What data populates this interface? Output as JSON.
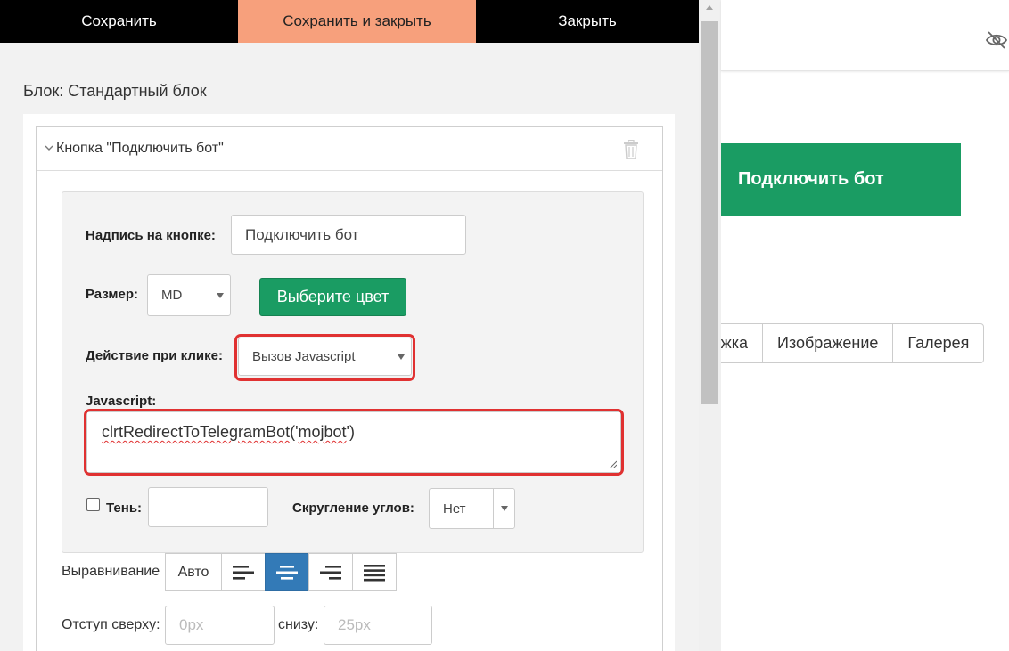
{
  "toolbar": {
    "save": "Сохранить",
    "save_close": "Сохранить и закрыть",
    "close": "Закрыть"
  },
  "editor": {
    "block_title": "Блок: Стандартный блок",
    "section_title": "Кнопка \"Подключить бот\"",
    "button_label_label": "Надпись на кнопке:",
    "button_label_value": "Подключить бот",
    "size_label": "Размер:",
    "size_value": "MD",
    "color_button": "Выберите цвет",
    "action_label": "Действие при клике:",
    "action_value": "Вызов Javascript",
    "js_label": "Javascript:",
    "js_value_a": "clrtRedirectToTelegramBot",
    "js_value_b": "('",
    "js_value_c": "mojbot",
    "js_value_d": "')",
    "shadow_label": "Тень:",
    "shadow_value": "",
    "rounding_label": "Скругление углов:",
    "rounding_value": "Нет",
    "align_label": "Выравнивание",
    "align_auto": "Авто",
    "align_active": "center",
    "offset_top_label": "Отступ сверху:",
    "offset_top_placeholder": "0px",
    "offset_bottom_label": "снизу:",
    "offset_bottom_placeholder": "25px"
  },
  "preview": {
    "button_text": "Подключить бот",
    "tabs": [
      "жка",
      "Изображение",
      "Галерея"
    ],
    "button_color": "#1a9c63"
  },
  "icons": [
    "chevron-down-icon",
    "trash-icon",
    "eye-off-icon",
    "align-left-icon",
    "align-center-icon",
    "align-right-icon",
    "align-justify-icon",
    "caret-down-icon",
    "resize-handle-icon"
  ]
}
